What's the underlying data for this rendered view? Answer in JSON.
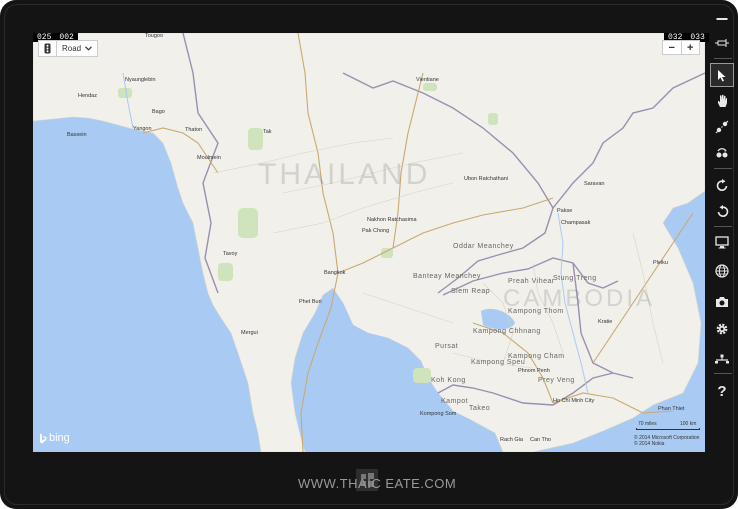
{
  "counters": {
    "left_a": "025",
    "left_b": "002",
    "right_a": "032",
    "right_b": "033"
  },
  "map_type": {
    "traffic_icon": "traffic-light-icon",
    "label": "Road",
    "chevron": "⌄"
  },
  "zoom": {
    "minus": "−",
    "plus": "+"
  },
  "bing_logo": "bing",
  "scale": {
    "miles": "70 miles",
    "km": "100 km"
  },
  "copyright": {
    "line1": "© 2014 Microsoft Corporation",
    "line2": "© 2014 Nokia"
  },
  "country_label": "THAILAND",
  "cambodia_label": "CAMBODIA",
  "watermark": "WWW.THAIC   EATE.COM",
  "toolbar": {
    "minimize": "—",
    "pin": "⊣",
    "pointer": "pointer-icon",
    "hand": "hand-icon",
    "pinch": "pinch-icon",
    "swipe": "swipe-icon",
    "rotate_cw": "rotate-cw-icon",
    "rotate_ccw": "rotate-ccw-icon",
    "display": "display-icon",
    "globe": "globe-icon",
    "camera": "camera-icon",
    "settings": "gear-icon",
    "network": "network-icon",
    "help": "?"
  },
  "places": [
    {
      "name": "Tougoo",
      "k": "city"
    },
    {
      "name": "Hendaz",
      "k": "city"
    },
    {
      "name": "Nyaunglebin",
      "k": "city"
    },
    {
      "name": "Bago",
      "k": "city"
    },
    {
      "name": "Bassein",
      "k": "city"
    },
    {
      "name": "Yangon",
      "k": "city"
    },
    {
      "name": "Thaton",
      "k": "city"
    },
    {
      "name": "Moulmein",
      "k": "city"
    },
    {
      "name": "Tak",
      "k": "city"
    },
    {
      "name": "Vientiane",
      "k": "city"
    },
    {
      "name": "Ubon Ratchathani",
      "k": "city"
    },
    {
      "name": "Nakhon Ratchasima",
      "k": "city"
    },
    {
      "name": "Pak Chong",
      "k": "city"
    },
    {
      "name": "Bangkok",
      "k": "city"
    },
    {
      "name": "Tavoy",
      "k": "city"
    },
    {
      "name": "Phet Buri",
      "k": "city"
    },
    {
      "name": "Mergui",
      "k": "city"
    },
    {
      "name": "Pakse",
      "k": "city"
    },
    {
      "name": "Champasak",
      "k": "city"
    },
    {
      "name": "Saravan",
      "k": "city"
    },
    {
      "name": "Pleiku",
      "k": "city"
    },
    {
      "name": "Kratie",
      "k": "city"
    },
    {
      "name": "Phnom Penh",
      "k": "city"
    },
    {
      "name": "Ho Chi Minh City",
      "k": "city"
    },
    {
      "name": "Kompong Som",
      "k": "city"
    },
    {
      "name": "Rach Gia",
      "k": "city"
    },
    {
      "name": "Can Tho",
      "k": "city"
    },
    {
      "name": "Phan Thiet",
      "k": "city"
    },
    {
      "name": "Kampong Speu",
      "k": "city"
    },
    {
      "name": "Pursat",
      "k": "city"
    },
    {
      "name": "Kampong Chhnang",
      "k": "city"
    },
    {
      "name": "Siem Reap",
      "k": "city"
    },
    {
      "name": "Preah Vihear",
      "k": "city"
    },
    {
      "name": "Kampong Thom",
      "k": "city"
    },
    {
      "name": "Kampong Cham",
      "k": "city"
    },
    {
      "name": "Koh Kong",
      "k": "city"
    },
    {
      "name": "Banteay Meanchey",
      "k": "city"
    },
    {
      "name": "Oddar Meanchey",
      "k": "city"
    },
    {
      "name": "Stung Treng",
      "k": "city"
    },
    {
      "name": "Prey Veng",
      "k": "city"
    },
    {
      "name": "Takeo",
      "k": "city"
    },
    {
      "name": "Kampot",
      "k": "city"
    }
  ]
}
